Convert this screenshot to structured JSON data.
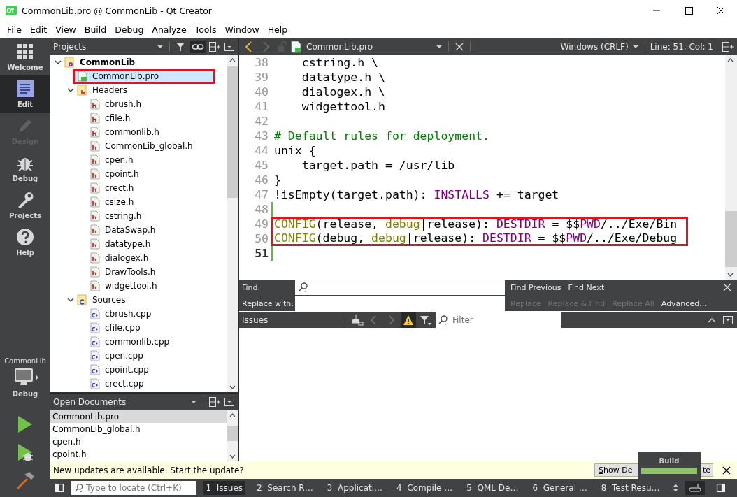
{
  "window": {
    "title": "CommonLib.pro @ CommonLib - Qt Creator"
  },
  "menu": [
    {
      "label": "File"
    },
    {
      "label": "Edit"
    },
    {
      "label": "View"
    },
    {
      "label": "Build"
    },
    {
      "label": "Debug"
    },
    {
      "label": "Analyze"
    },
    {
      "label": "Tools"
    },
    {
      "label": "Window"
    },
    {
      "label": "Help"
    }
  ],
  "mode_bar": {
    "modes": [
      {
        "kind": "welcome",
        "label": "Welcome",
        "selected": false,
        "disabled": false
      },
      {
        "kind": "edit",
        "label": "Edit",
        "selected": true,
        "disabled": false
      },
      {
        "kind": "design",
        "label": "Design",
        "selected": false,
        "disabled": true
      },
      {
        "kind": "debug",
        "label": "Debug",
        "selected": false,
        "disabled": false
      },
      {
        "kind": "projects",
        "label": "Projects",
        "selected": false,
        "disabled": false
      },
      {
        "kind": "help",
        "label": "Help",
        "selected": false,
        "disabled": false
      }
    ],
    "target": {
      "project": "CommonLib",
      "config": "Debug"
    }
  },
  "projects_pane": {
    "title": "Projects",
    "tree": [
      {
        "kind": "project",
        "label": "CommonLib",
        "expanded": true,
        "selected": false,
        "highlighted": false,
        "children": [
          {
            "kind": "pro",
            "label": "CommonLib.pro",
            "selected": true,
            "highlighted": true
          },
          {
            "kind": "header-folder",
            "label": "Headers",
            "expanded": true,
            "selected": false,
            "highlighted": false,
            "children": [
              {
                "kind": "header",
                "label": "cbrush.h",
                "selected": false,
                "highlighted": false
              },
              {
                "kind": "header",
                "label": "cfile.h",
                "selected": false,
                "highlighted": false
              },
              {
                "kind": "header",
                "label": "commonlib.h",
                "selected": false,
                "highlighted": false
              },
              {
                "kind": "header",
                "label": "CommonLib_global.h",
                "selected": false,
                "highlighted": false
              },
              {
                "kind": "header",
                "label": "cpen.h",
                "selected": false,
                "highlighted": false
              },
              {
                "kind": "header",
                "label": "cpoint.h",
                "selected": false,
                "highlighted": false
              },
              {
                "kind": "header",
                "label": "crect.h",
                "selected": false,
                "highlighted": false
              },
              {
                "kind": "header",
                "label": "csize.h",
                "selected": false,
                "highlighted": false
              },
              {
                "kind": "header",
                "label": "cstring.h",
                "selected": false,
                "highlighted": false
              },
              {
                "kind": "header",
                "label": "DataSwap.h",
                "selected": false,
                "highlighted": false
              },
              {
                "kind": "header",
                "label": "datatype.h",
                "selected": false,
                "highlighted": false
              },
              {
                "kind": "header",
                "label": "dialogex.h",
                "selected": false,
                "highlighted": false
              },
              {
                "kind": "header",
                "label": "DrawTools.h",
                "selected": false,
                "highlighted": false
              },
              {
                "kind": "header",
                "label": "widgettool.h",
                "selected": false,
                "highlighted": false
              }
            ]
          },
          {
            "kind": "source-folder",
            "label": "Sources",
            "expanded": true,
            "selected": false,
            "highlighted": false,
            "children": [
              {
                "kind": "source",
                "label": "cbrush.cpp",
                "selected": false,
                "highlighted": false
              },
              {
                "kind": "source",
                "label": "cfile.cpp",
                "selected": false,
                "highlighted": false
              },
              {
                "kind": "source",
                "label": "commonlib.cpp",
                "selected": false,
                "highlighted": false
              },
              {
                "kind": "source",
                "label": "cpen.cpp",
                "selected": false,
                "highlighted": false
              },
              {
                "kind": "source",
                "label": "cpoint.cpp",
                "selected": false,
                "highlighted": false
              },
              {
                "kind": "source",
                "label": "crect.cpp",
                "selected": false,
                "highlighted": false
              }
            ]
          }
        ]
      }
    ]
  },
  "open_documents": {
    "title": "Open Documents",
    "items": [
      {
        "label": "CommonLib.pro",
        "selected": true
      },
      {
        "label": "CommonLib_global.h",
        "selected": false
      },
      {
        "label": "cpen.h",
        "selected": false
      },
      {
        "label": "cpoint.h",
        "selected": false
      }
    ]
  },
  "editor": {
    "file": "CommonLib.pro",
    "line_ending": "Windows (CRLF)",
    "position": "Line: 51, Col: 1",
    "lines": [
      {
        "number": "38",
        "current": false,
        "modified": false,
        "highlighted": false,
        "tokens": [
          {
            "kind": "text",
            "text": "    cstring.h \\"
          }
        ]
      },
      {
        "number": "39",
        "current": false,
        "modified": false,
        "highlighted": false,
        "tokens": [
          {
            "kind": "text",
            "text": "    datatype.h \\"
          }
        ]
      },
      {
        "number": "40",
        "current": false,
        "modified": false,
        "highlighted": false,
        "tokens": [
          {
            "kind": "text",
            "text": "    dialogex.h \\"
          }
        ]
      },
      {
        "number": "41",
        "current": false,
        "modified": false,
        "highlighted": false,
        "tokens": [
          {
            "kind": "text",
            "text": "    widgettool.h"
          }
        ]
      },
      {
        "number": "42",
        "current": false,
        "modified": false,
        "highlighted": false
      },
      {
        "number": "43",
        "current": false,
        "modified": false,
        "highlighted": false,
        "tokens": [
          {
            "kind": "comment",
            "text": "# Default rules for deployment."
          }
        ]
      },
      {
        "number": "44",
        "current": false,
        "modified": false,
        "highlighted": false,
        "tokens": [
          {
            "kind": "text",
            "text": "unix {"
          }
        ]
      },
      {
        "number": "45",
        "current": false,
        "modified": false,
        "highlighted": false,
        "tokens": [
          {
            "kind": "text",
            "text": "    target.path = /usr/lib"
          }
        ]
      },
      {
        "number": "46",
        "current": false,
        "modified": false,
        "highlighted": false,
        "tokens": [
          {
            "kind": "text",
            "text": "}"
          }
        ]
      },
      {
        "number": "47",
        "current": false,
        "modified": false,
        "highlighted": false,
        "tokens": [
          {
            "kind": "text",
            "text": "!isEmpty(target.path): "
          },
          {
            "kind": "variable",
            "text": "INSTALLS"
          },
          {
            "kind": "text",
            "text": " += target"
          }
        ]
      },
      {
        "number": "48",
        "current": false,
        "modified": true,
        "highlighted": false
      },
      {
        "number": "49",
        "current": false,
        "modified": true,
        "highlighted": true,
        "tokens": [
          {
            "kind": "function",
            "text": "CONFIG"
          },
          {
            "kind": "text",
            "text": "(release, "
          },
          {
            "kind": "function",
            "text": "debug"
          },
          {
            "kind": "text",
            "text": "|release): "
          },
          {
            "kind": "variable",
            "text": "DESTDIR"
          },
          {
            "kind": "text",
            "text": " = $$"
          },
          {
            "kind": "variable",
            "text": "PWD"
          },
          {
            "kind": "text",
            "text": "/../Exe/Bin"
          }
        ]
      },
      {
        "number": "50",
        "current": false,
        "modified": true,
        "highlighted": true,
        "tokens": [
          {
            "kind": "function",
            "text": "CONFIG"
          },
          {
            "kind": "text",
            "text": "(debug, "
          },
          {
            "kind": "function",
            "text": "debug"
          },
          {
            "kind": "text",
            "text": "|release): "
          },
          {
            "kind": "variable",
            "text": "DESTDIR"
          },
          {
            "kind": "text",
            "text": " = $$"
          },
          {
            "kind": "variable",
            "text": "PWD"
          },
          {
            "kind": "text",
            "text": "/../Exe/Debug"
          }
        ]
      },
      {
        "number": "51",
        "current": true,
        "modified": true,
        "highlighted": false
      }
    ]
  },
  "find_bar": {
    "find_label": "Find:",
    "replace_label": "Replace with:",
    "find_buttons": [
      {
        "label": "Find Previous",
        "disabled": false
      },
      {
        "label": "Find Next",
        "disabled": false
      }
    ],
    "replace_buttons": [
      {
        "label": "Replace",
        "disabled": true
      },
      {
        "label": "Replace & Find",
        "disabled": true
      },
      {
        "label": "Replace All",
        "disabled": true
      },
      {
        "label": "Advanced...",
        "disabled": false
      }
    ]
  },
  "issues": {
    "title": "Issues",
    "warnings_filter_on": true,
    "filter_placeholder": "Filter"
  },
  "update_bar": {
    "message": "New updates are available. Start the update?",
    "button_start": "Show De",
    "button_end": "te"
  },
  "build_progress": {
    "title": "Build",
    "level": 1
  },
  "status_bar": {
    "locate_placeholder": "Type to locate (Ctrl+K)",
    "panes": [
      {
        "number": "1",
        "label": "Issues",
        "selected": true
      },
      {
        "number": "2",
        "label": "Search R…",
        "selected": false
      },
      {
        "number": "3",
        "label": "Applicati…",
        "selected": false
      },
      {
        "number": "4",
        "label": "Compile …",
        "selected": false
      },
      {
        "number": "5",
        "label": "QML De…",
        "selected": false
      },
      {
        "number": "6",
        "label": "General …",
        "selected": false
      },
      {
        "number": "8",
        "label": "Test Resu…",
        "selected": false
      }
    ]
  }
}
